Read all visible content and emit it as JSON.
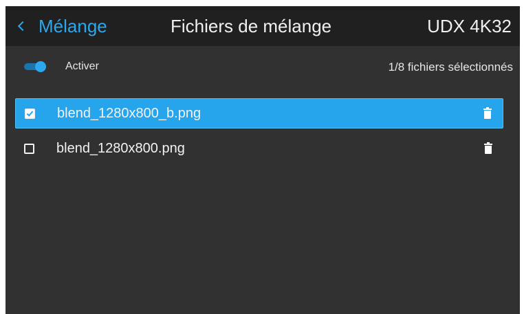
{
  "header": {
    "back_label": "Mélange",
    "title": "Fichiers de mélange",
    "device": "UDX 4K32"
  },
  "controls": {
    "toggle_label": "Activer",
    "toggle_on": true,
    "selection_count": "1/8 fichiers sélectionnés"
  },
  "files": [
    {
      "name": "blend_1280x800_b.png",
      "checked": true
    },
    {
      "name": "blend_1280x800.png",
      "checked": false
    }
  ],
  "icons": {
    "back": "chevron-left-icon",
    "delete": "trash-icon",
    "toggle": "toggle-switch-icon"
  },
  "colors": {
    "accent": "#27a5ec",
    "background": "#313131",
    "header_background": "#202020",
    "text": "#eaeaea"
  }
}
